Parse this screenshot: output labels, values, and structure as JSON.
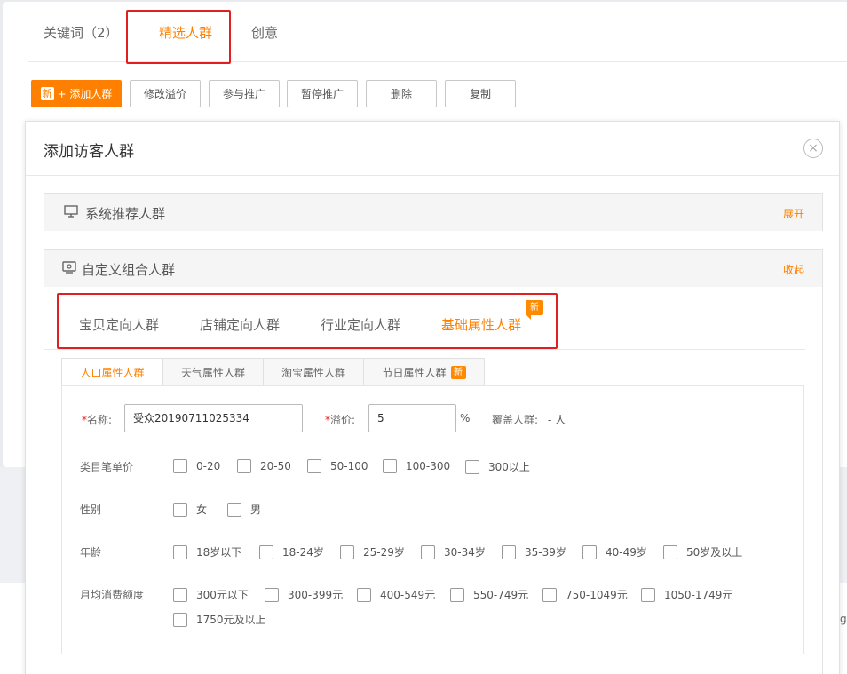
{
  "tabs": [
    {
      "label": "关键词（2）"
    },
    {
      "label": "精选人群"
    },
    {
      "label": "创意"
    }
  ],
  "toolbar": {
    "add_new_tag": "新",
    "add_label": "+ 添加人群",
    "edit_premium": "修改溢价",
    "join_promo": "参与推广",
    "pause_promo": "暂停推广",
    "delete": "删除",
    "copy": "复制"
  },
  "modal": {
    "title": "添加访客人群",
    "close_glyph": "×"
  },
  "system_section": {
    "title": "系统推荐人群",
    "toggle": "展开"
  },
  "custom_section": {
    "title": "自定义组合人群",
    "toggle": "收起"
  },
  "category_tabs": [
    {
      "label": "宝贝定向人群"
    },
    {
      "label": "店铺定向人群"
    },
    {
      "label": "行业定向人群"
    },
    {
      "label": "基础属性人群"
    }
  ],
  "category_new_badge": "新",
  "sub_tabs": [
    {
      "label": "人口属性人群"
    },
    {
      "label": "天气属性人群"
    },
    {
      "label": "淘宝属性人群"
    },
    {
      "label": "节日属性人群"
    }
  ],
  "sub_tab_new_badge": "新",
  "form": {
    "name_required": "*",
    "name_label": "名称:",
    "name_value": "受众20190711025334",
    "premium_required": "*",
    "premium_label": "溢价:",
    "premium_value": "5",
    "premium_unit": "%",
    "coverage_label": "覆盖人群:",
    "coverage_value": "- 人"
  },
  "filters": {
    "price": {
      "label": "类目笔单价",
      "options": [
        "0-20",
        "20-50",
        "50-100",
        "100-300",
        "300以上"
      ]
    },
    "gender": {
      "label": "性别",
      "options": [
        "女",
        "男"
      ]
    },
    "age": {
      "label": "年龄",
      "options": [
        "18岁以下",
        "18-24岁",
        "25-29岁",
        "30-34岁",
        "35-39岁",
        "40-49岁",
        "50岁及以上"
      ]
    },
    "spend": {
      "label": "月均消费额度",
      "options": [
        "300元以下",
        "300-399元",
        "400-549元",
        "550-749元",
        "750-1049元",
        "1050-1749元",
        "1750元及以上"
      ]
    }
  },
  "edge_fragment": "g"
}
